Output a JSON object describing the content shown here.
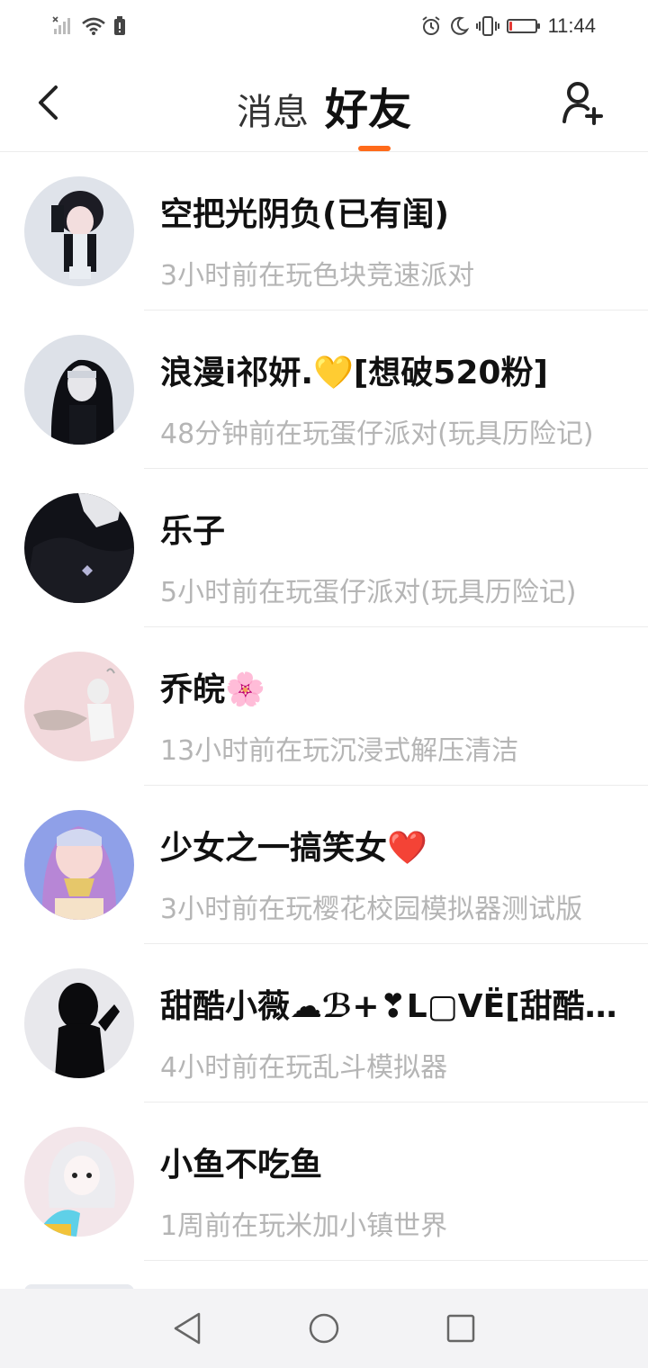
{
  "status_bar": {
    "time": "11:44",
    "icons": [
      "no-signal-icon",
      "wifi-icon",
      "battery-alert-icon",
      "alarm-icon",
      "moon-icon",
      "vibrate-icon",
      "battery-low-icon"
    ],
    "battery_level": 0.1,
    "battery_color": "#e53935"
  },
  "header": {
    "back_icon": "back-arrow-icon",
    "tabs": [
      {
        "label": "消息",
        "active": false
      },
      {
        "label": "好友",
        "active": true
      }
    ],
    "add_friend_icon": "add-user-icon",
    "accent_color": "#ff6a1a"
  },
  "friends": [
    {
      "name": "空把光阴负(已有闺)",
      "status": "3小时前在玩色块竞速派对"
    },
    {
      "name": "浪漫i祁妍.💛[想破520粉]",
      "status": "48分钟前在玩蛋仔派对(玩具历险记)"
    },
    {
      "name": "乐子",
      "status": "5小时前在玩蛋仔派对(玩具历险记)"
    },
    {
      "name": "乔皖🌸",
      "status": "13小时前在玩沉浸式解压清洁"
    },
    {
      "name": "少女之一搞笑女❤️",
      "status": "3小时前在玩樱花校园模拟器测试版"
    },
    {
      "name": "甜酷小薇☁ℬ+❣L▢VË[甜酷团]",
      "status": "4小时前在玩乱斗模拟器"
    },
    {
      "name": "小鱼不吃鱼",
      "status": "1周前在玩米加小镇世界"
    }
  ],
  "nav_bar": {
    "buttons": [
      "back-triangle-icon",
      "home-circle-icon",
      "recents-square-icon"
    ]
  }
}
